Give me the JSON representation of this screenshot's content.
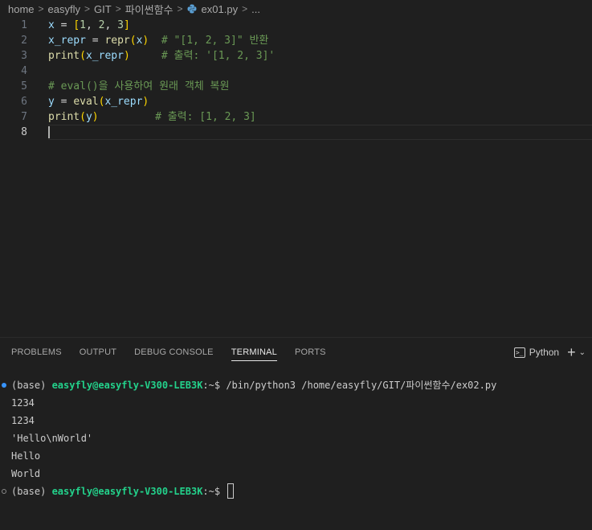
{
  "breadcrumb": {
    "items": [
      "home",
      "easyfly",
      "GIT",
      "파이썬함수",
      "ex01.py",
      "..."
    ],
    "separator": ">"
  },
  "editor": {
    "lines": [
      {
        "n": "1",
        "tokens": [
          [
            "x",
            "var"
          ],
          [
            " = ",
            "op"
          ],
          [
            "[",
            "br1"
          ],
          [
            "1",
            "num"
          ],
          [
            ", ",
            "op"
          ],
          [
            "2",
            "num"
          ],
          [
            ", ",
            "op"
          ],
          [
            "3",
            "num"
          ],
          [
            "]",
            "br1"
          ]
        ]
      },
      {
        "n": "2",
        "tokens": [
          [
            "x_repr",
            "var"
          ],
          [
            " = ",
            "op"
          ],
          [
            "repr",
            "fn"
          ],
          [
            "(",
            "br1"
          ],
          [
            "x",
            "var"
          ],
          [
            ")",
            "br1"
          ],
          [
            "  # \"[1, 2, 3]\" 반환",
            "cm"
          ]
        ]
      },
      {
        "n": "3",
        "tokens": [
          [
            "print",
            "fn"
          ],
          [
            "(",
            "br1"
          ],
          [
            "x_repr",
            "var"
          ],
          [
            ")",
            "br1"
          ],
          [
            "     # 출력: '[1, 2, 3]'",
            "cm"
          ]
        ]
      },
      {
        "n": "4",
        "tokens": []
      },
      {
        "n": "5",
        "tokens": [
          [
            "# eval()을 사용하여 원래 객체 복원",
            "cm"
          ]
        ]
      },
      {
        "n": "6",
        "tokens": [
          [
            "y",
            "var"
          ],
          [
            " = ",
            "op"
          ],
          [
            "eval",
            "fn"
          ],
          [
            "(",
            "br1"
          ],
          [
            "x_repr",
            "var"
          ],
          [
            ")",
            "br1"
          ]
        ]
      },
      {
        "n": "7",
        "tokens": [
          [
            "print",
            "fn"
          ],
          [
            "(",
            "br1"
          ],
          [
            "y",
            "var"
          ],
          [
            ")",
            "br1"
          ],
          [
            "         # 출력: [1, 2, 3]",
            "cm"
          ]
        ]
      },
      {
        "n": "8",
        "tokens": []
      }
    ],
    "current_line": "8"
  },
  "panel": {
    "tabs": [
      "PROBLEMS",
      "OUTPUT",
      "DEBUG CONSOLE",
      "TERMINAL",
      "PORTS"
    ],
    "active_tab": "TERMINAL",
    "profile_label": "Python",
    "profile_icon": "terminal-icon",
    "new_icon": "plus-icon",
    "dropdown_icon": "chevron-down-icon"
  },
  "terminal": {
    "prompt_env": "(base) ",
    "prompt_user": "easyfly@easyfly-V300-LEB3K",
    "prompt_suffix": ":~$ ",
    "command": "/bin/python3 /home/easyfly/GIT/파이썬함수/ex02.py",
    "output": [
      "1234",
      "1234",
      "'Hello\\nWorld'",
      "Hello",
      "World"
    ],
    "colors": {
      "user": "#23d18b",
      "dot_success": "#3794ff"
    }
  }
}
